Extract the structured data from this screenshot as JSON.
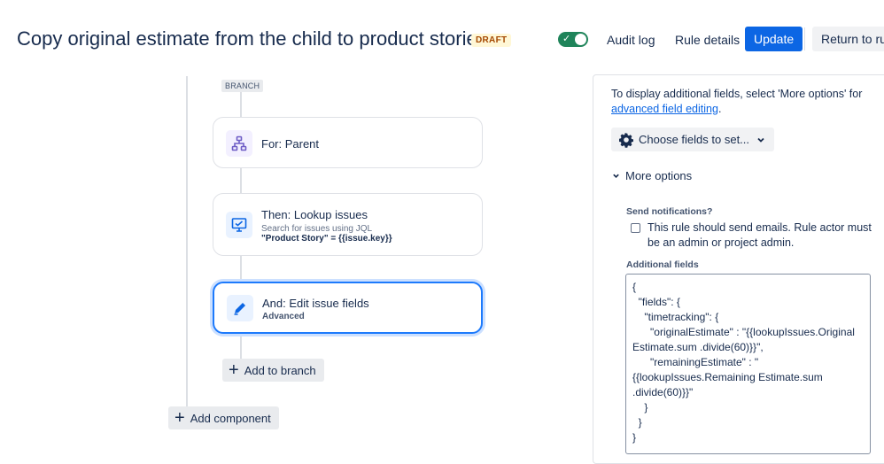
{
  "header": {
    "title": "Copy original estimate from the child to product stories",
    "badge": "DRAFT",
    "toggle_on": true,
    "audit_log": "Audit log",
    "rule_details": "Rule details",
    "update": "Update",
    "return_to_rules": "Return to rule"
  },
  "flow": {
    "branch_label": "BRANCH",
    "steps": [
      {
        "title": "For: Parent",
        "icon": "hierarchy-icon"
      },
      {
        "title": "Then: Lookup issues",
        "subtitle": "Search for issues using JQL",
        "jql": "\"Product Story\" = {{issue.key}}",
        "icon": "monitor-icon"
      },
      {
        "title": "And: Edit issue fields",
        "subtitle": "Advanced",
        "icon": "pencil-icon",
        "selected": true
      }
    ],
    "add_to_branch": "Add to branch",
    "add_component": "Add component"
  },
  "panel": {
    "intro": "To display additional fields, select 'More options' for",
    "intro_link": "advanced field editing",
    "intro_end": ".",
    "choose_fields": "Choose fields to set...",
    "more_options": "More options",
    "send_notifications_label": "Send notifications?",
    "send_notifications_text": "This rule should send emails. Rule actor must be an admin or project admin.",
    "send_notifications_checked": false,
    "additional_fields_label": "Additional fields",
    "additional_fields_value": "{\n  \"fields\": {\n    \"timetracking\": {\n      \"originalEstimate\" : \"{{lookupIssues.Original Estimate.sum .divide(60)}}\",\n      \"remainingEstimate\" : \"\n{{lookupIssues.Remaining Estimate.sum\n.divide(60)}}\"\n    }\n  }\n}"
  },
  "colors": {
    "primary": "#0c66e4",
    "toggle": "#1f845a",
    "selected_border": "#1d7afc",
    "badge_bg": "#fff7d6",
    "badge_text": "#a54800"
  }
}
